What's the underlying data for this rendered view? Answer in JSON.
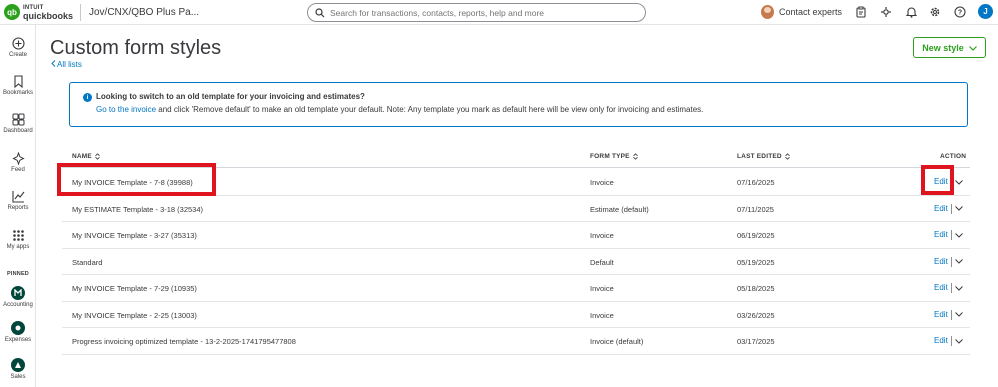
{
  "topbar": {
    "logo_text": "qb",
    "brand_intuit": "INTUIT",
    "brand_name": "quickbooks",
    "company": "Jov/CNX/QBO Plus Pa...",
    "search_placeholder": "Search for transactions, contacts, reports, help and more",
    "contact_experts": "Contact experts",
    "user_initial": "J"
  },
  "leftnav": {
    "items": [
      {
        "label": "Create",
        "icon": "plus-circle-icon"
      },
      {
        "label": "Bookmarks",
        "icon": "bookmark-icon"
      },
      {
        "label": "Dashboard",
        "icon": "dashboard-icon"
      },
      {
        "label": "Feed",
        "icon": "feed-icon"
      },
      {
        "label": "Reports",
        "icon": "reports-icon"
      },
      {
        "label": "My apps",
        "icon": "apps-grid-icon"
      }
    ],
    "pinned_label": "PINNED",
    "pinned": [
      {
        "label": "Accounting",
        "icon": "accounting-app-icon"
      },
      {
        "label": "Expenses",
        "icon": "expenses-app-icon"
      },
      {
        "label": "Sales",
        "icon": "sales-app-icon"
      }
    ]
  },
  "page": {
    "title": "Custom form styles",
    "back_link": "All lists",
    "new_style_label": "New style"
  },
  "banner": {
    "title": "Looking to switch to an old template for your invoicing and estimates?",
    "link_text": "Go to the invoice",
    "body": " and click 'Remove default' to make an old template your default. Note: Any template you mark as default here will be view only for invoicing and estimates."
  },
  "table": {
    "headers": {
      "name": "NAME",
      "form_type": "FORM TYPE",
      "last_edited": "LAST EDITED",
      "action": "ACTION"
    },
    "edit_label": "Edit",
    "rows": [
      {
        "name": "My INVOICE Template - 7-8 (39988)",
        "form_type": "Invoice",
        "last_edited": "07/16/2025"
      },
      {
        "name": "My ESTIMATE Template - 3-18 (32534)",
        "form_type": "Estimate (default)",
        "last_edited": "07/11/2025"
      },
      {
        "name": "My INVOICE Template - 3-27 (35313)",
        "form_type": "Invoice",
        "last_edited": "06/19/2025"
      },
      {
        "name": "Standard",
        "form_type": "Default",
        "last_edited": "05/19/2025"
      },
      {
        "name": "My INVOICE Template - 7-29 (10935)",
        "form_type": "Invoice",
        "last_edited": "05/18/2025"
      },
      {
        "name": "My INVOICE Template - 2-25 (13003)",
        "form_type": "Invoice",
        "last_edited": "03/26/2025"
      },
      {
        "name": "Progress invoicing optimized template - 13-2-2025-1741795477808",
        "form_type": "Invoice (default)",
        "last_edited": "03/17/2025"
      }
    ]
  },
  "colors": {
    "brand_green": "#2ca01c",
    "link_blue": "#0077c5",
    "highlight_red": "#e0141e"
  }
}
